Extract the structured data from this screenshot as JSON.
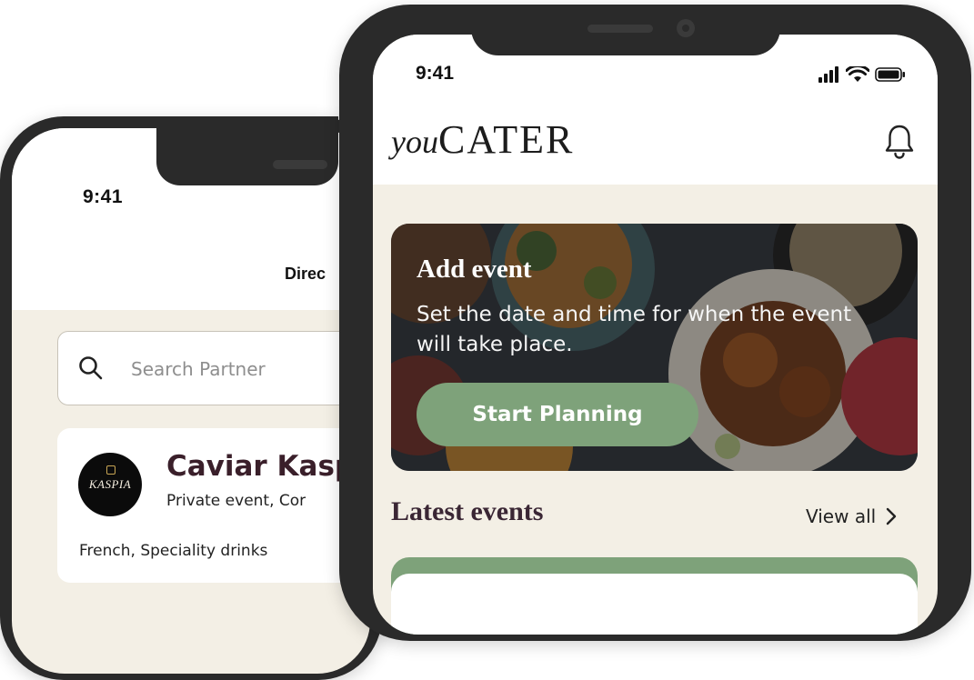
{
  "back_phone": {
    "status_time": "9:41",
    "screen_title": "Direc",
    "search": {
      "placeholder": "Search Partner",
      "value": ""
    },
    "partner": {
      "logo_text": "KASPIA",
      "name": "Caviar Kasp",
      "type": "Private event, Cor",
      "cuisine": "French, Speciality drinks"
    }
  },
  "front_phone": {
    "status_time": "9:41",
    "logo": {
      "you": "you",
      "cater": "CATER"
    },
    "hero": {
      "title": "Add event",
      "description": "Set the date and time for when the event will take place.",
      "button_label": "Start Planning"
    },
    "latest_events": {
      "title": "Latest events",
      "view_all_label": "View all"
    }
  },
  "colors": {
    "accent_green": "#7ea27a",
    "screen_bg": "#f3efe5",
    "phone_frame": "#2a2a2a",
    "heading_dark": "#3a2634"
  },
  "icons": [
    "search-icon",
    "bell-icon",
    "signal-icon",
    "wifi-icon",
    "battery-icon",
    "chevron-right-icon"
  ]
}
